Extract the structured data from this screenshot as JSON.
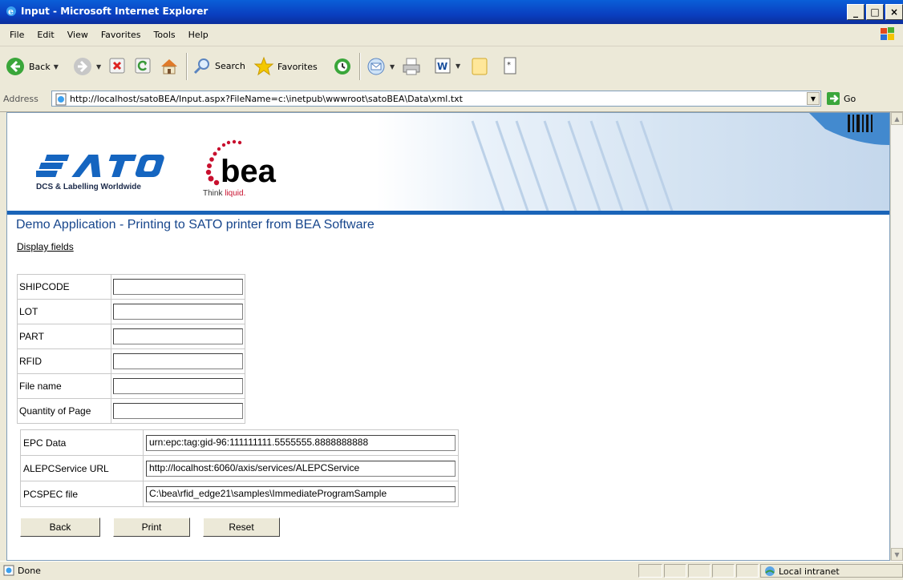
{
  "window": {
    "title": "Input - Microsoft Internet Explorer",
    "minimize": "_",
    "maximize": "□",
    "close": "×"
  },
  "menu": [
    "File",
    "Edit",
    "View",
    "Favorites",
    "Tools",
    "Help"
  ],
  "toolbar": {
    "back": "Back",
    "search": "Search",
    "favorites": "Favorites"
  },
  "address": {
    "label": "Address",
    "url": "http://localhost/satoBEA/Input.aspx?FileName=c:\\inetpub\\wwwroot\\satoBEA\\Data\\xml.txt",
    "go": "Go"
  },
  "page": {
    "sato_tagline": "DCS & Labelling Worldwide",
    "bea_name": "bea",
    "bea_think": "Think",
    "bea_liquid": "liquid.",
    "heading": "Demo Application - Printing to SATO printer from BEA Software",
    "display_fields": "Display fields",
    "fields": [
      {
        "label": "SHIPCODE",
        "value": ""
      },
      {
        "label": "LOT",
        "value": ""
      },
      {
        "label": "PART",
        "value": ""
      },
      {
        "label": "RFID",
        "value": ""
      },
      {
        "label": "File name",
        "value": ""
      },
      {
        "label": "Quantity of Page",
        "value": ""
      }
    ],
    "rfid_fields": [
      {
        "label": "EPC Data",
        "value": "urn:epc:tag:gid-96:111111111.5555555.8888888888"
      },
      {
        "label": "ALEPCService URL",
        "value": "http://localhost:6060/axis/services/ALEPCService"
      },
      {
        "label": "PCSPEC file",
        "value": "C:\\bea\\rfid_edge21\\samples\\ImmediateProgramSample"
      }
    ],
    "buttons": {
      "back": "Back",
      "print": "Print",
      "reset": "Reset"
    }
  },
  "status": {
    "text": "Done",
    "zone": "Local intranet"
  }
}
